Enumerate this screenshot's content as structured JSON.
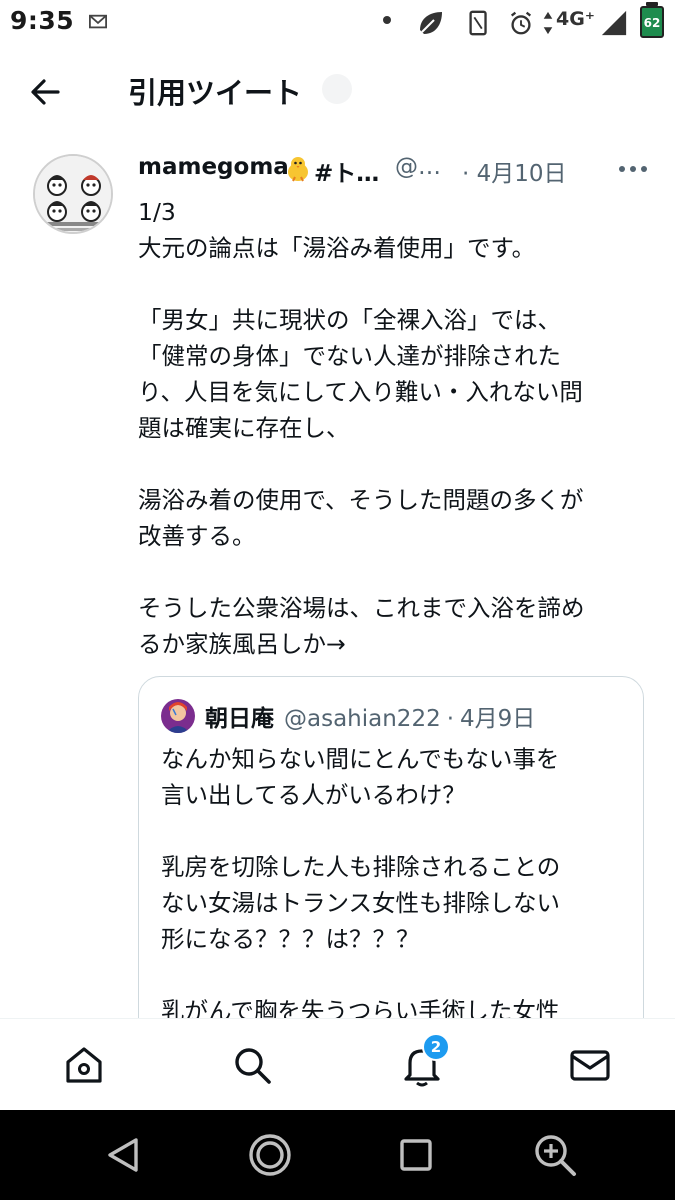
{
  "status_bar": {
    "time": "9:35",
    "network": "4G⁺",
    "battery": "62",
    "icons": [
      "mail-icon",
      "dot-icon",
      "leaf-icon",
      "vibrate-icon",
      "alarm-icon",
      "data-arrows-icon",
      "signal-icon",
      "battery-icon"
    ]
  },
  "header": {
    "title": "引用ツイート",
    "back_icon": "back-arrow-icon"
  },
  "tweet": {
    "author_name": "mamegoma",
    "author_name_suffix": "#ト…",
    "author_handle": "@…",
    "date": "· 4月10日",
    "more_icon": "more-icon",
    "body": [
      "1/3",
      "大元の論点は「湯浴み着使用」です。",
      "",
      "「男女」共に現状の「全裸入浴」では、",
      "「健常の身体」でない人達が排除された",
      "り、人目を気にして入り難い・入れない問",
      "題は確実に存在し、",
      "",
      "湯浴み着の使用で、そうした問題の多くが",
      "改善する。",
      "",
      "そうした公衆浴場は、これまで入浴を諦め",
      "るか家族風呂しか→"
    ]
  },
  "quoted_tweet": {
    "name": "朝日庵",
    "handle": "@asahian222",
    "separator": "·",
    "date": "4月9日",
    "body": [
      "なんか知らない間にとんでもない事を",
      "言い出してる人がいるわけ？",
      "",
      "乳房を切除した人も排除されることの",
      "ない女湯はトランス女性も排除しない",
      "形になる？？？は？？？",
      "",
      "乳がんで胸を失うつらい手術した女性"
    ]
  },
  "bottom_nav": {
    "items": [
      "home-icon",
      "search-icon",
      "notifications-icon",
      "messages-icon"
    ],
    "notification_count": "2"
  },
  "system_nav": {
    "items": [
      "back-triangle-icon",
      "home-circle-icon",
      "recents-square-icon",
      "magnifier-icon"
    ]
  },
  "colors": {
    "accent": "#1d9bf0",
    "text": "#0f1419",
    "secondary_text": "#536471",
    "border": "#cfd9de",
    "system_nav_bg": "#000000"
  }
}
